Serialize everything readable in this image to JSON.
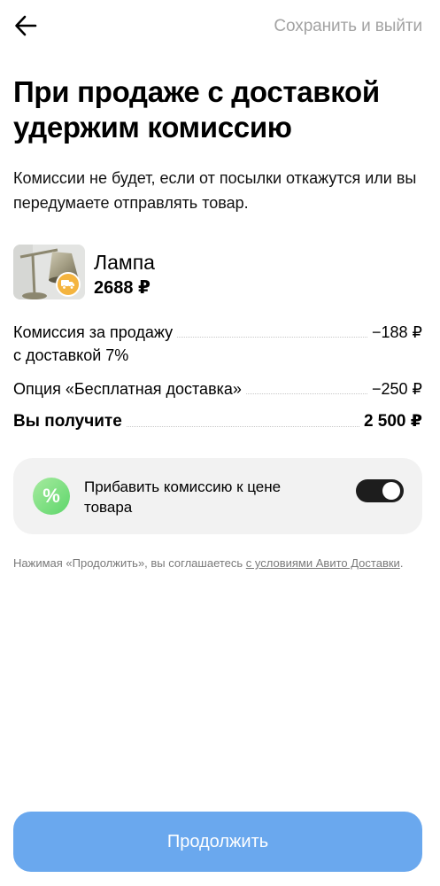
{
  "header": {
    "save_exit_label": "Сохранить и выйти"
  },
  "title": "При продаже с доставкой удержим комиссию",
  "subtitle": "Комиссии не будет, если от посылки откажутся или вы передумаете отправлять товар.",
  "product": {
    "name": "Лампа",
    "price": "2688 ₽"
  },
  "breakdown": {
    "commission_label_line1": "Комиссия за продажу",
    "commission_label_line2": "с доставкой 7%",
    "commission_value": "−188 ₽",
    "delivery_label": "Опция «Бесплатная доставка»",
    "delivery_value": "−250 ₽",
    "total_label": "Вы получите",
    "total_value": "2 500 ₽"
  },
  "toggle": {
    "label": "Прибавить комиссию к цене товара",
    "enabled": true
  },
  "legal": {
    "prefix": "Нажимая «Продолжить», вы соглашаетесь ",
    "link_text": "с условиями Авито Доставки",
    "suffix": "."
  },
  "continue_label": "Продолжить",
  "colors": {
    "primary_button": "#6aa8ee",
    "switch_on": "#1d1d1d",
    "card_bg": "#f2f2f2",
    "muted_text": "#a3a3a3",
    "delivery_badge": "#f4b43f",
    "percent_icon": "#5dd66a"
  }
}
